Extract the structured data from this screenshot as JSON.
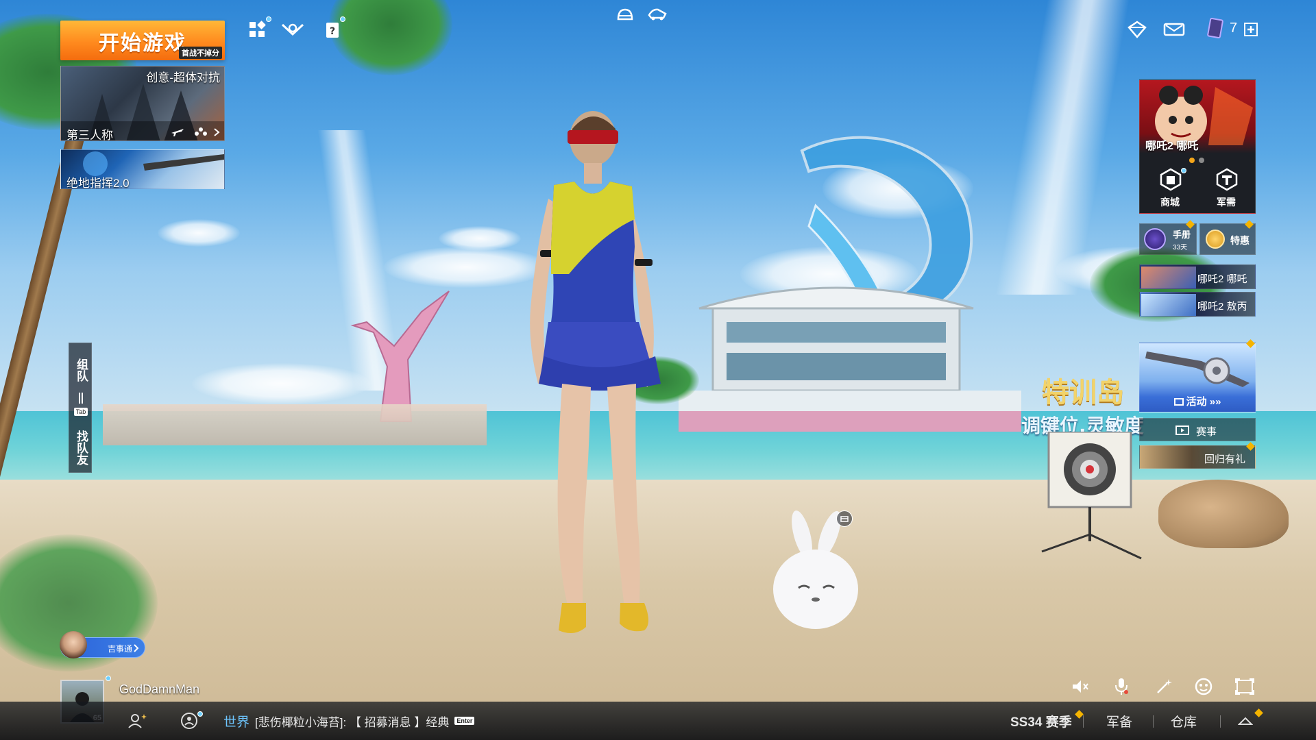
{
  "start": {
    "label": "开始游戏",
    "sub": "首战不掉分"
  },
  "modes": {
    "main": {
      "title": "创意-超体对抗",
      "perspective": "第三人称"
    },
    "sub": {
      "title": "绝地指挥2.0"
    }
  },
  "top_right": {
    "card_count": "7"
  },
  "team": {
    "team_label": "组队",
    "tab_key": "Tab",
    "find_label": "找队友"
  },
  "right_panel": {
    "banner": {
      "title": "哪吒2 哪吒"
    },
    "shop": "商城",
    "supply": "军需",
    "handbook": {
      "label": "手册",
      "days": "33天"
    },
    "deal": "特惠",
    "promo1": "哪吒2 哪吒",
    "promo2": "哪吒2 敖丙",
    "activity": "活动",
    "events": "赛事",
    "return": "回归有礼"
  },
  "scene_text": {
    "island_title": "特训岛",
    "island_sub": "调键位,灵敏度"
  },
  "friend": {
    "label": "吉事通"
  },
  "user": {
    "name": "GodDamnMan",
    "level": "65"
  },
  "chat": {
    "channel": "世界",
    "message": "[悲伤椰粒小海苔]: 【 招募消息 】经典",
    "enter_key": "Enter"
  },
  "bottom_nav": {
    "season": "SS34 赛季",
    "gear": "军备",
    "warehouse": "仓库"
  },
  "colors": {
    "accent": "#ff8a1e",
    "bar": "#14181e",
    "chat_channel": "#6ec6ff"
  }
}
